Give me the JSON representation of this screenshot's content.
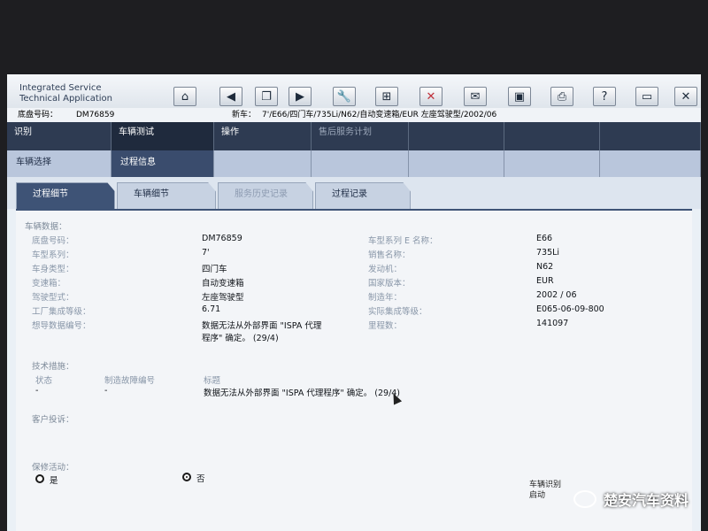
{
  "app": {
    "title_line1": "Integrated Service",
    "title_line2": "Technical Application"
  },
  "toolbar": {
    "icons": [
      "home-icon",
      "back-icon",
      "copy-icon",
      "forward-icon",
      "wrench-icon",
      "network-icon",
      "disconnect-icon",
      "mail-icon",
      "device-icon",
      "print-icon",
      "help-icon",
      "window-icon",
      "close-icon"
    ]
  },
  "vehicle_bar": {
    "chassis_label": "底盘号码：",
    "chassis_value": "DM76859",
    "new_car_label": "新车：",
    "new_car_value": "7'/E66/四门车/735Li/N62/自动变速箱/EUR 左座驾驶型/2002/06"
  },
  "nav_main": [
    "识别",
    "车辆测试",
    "操作",
    "售后服务计划",
    "",
    "",
    ""
  ],
  "nav_sub": [
    "车辆选择",
    "过程信息"
  ],
  "tabs": [
    "过程细节",
    "车辆细节",
    "服务历史记录",
    "过程记录"
  ],
  "vehicle_data": {
    "section_title": "车辆数据：",
    "left_labels": [
      "底盘号码：",
      "车型系列：",
      "车身类型：",
      "变速箱：",
      "驾驶型式：",
      "工厂集成等级：",
      "想导数据编号："
    ],
    "left_values": [
      "DM76859",
      "7'",
      "四门车",
      "自动变速箱",
      "左座驾驶型",
      "6.71",
      "数据无法从外部界面 \"ISPA 代理",
      "程序\" 确定。 (29/4)"
    ],
    "right_labels": [
      "车型系列 E 名称：",
      "销售名称：",
      "发动机：",
      "国家版本：",
      "制造年：",
      "实际集成等级：",
      "里程数："
    ],
    "right_values": [
      "E66",
      "735Li",
      "N62",
      "EUR",
      "2002 / 06",
      "E065-06-09-800",
      "141097"
    ]
  },
  "technical_measures": {
    "section_title": "技术措施：",
    "col1": "状态",
    "col2": "制造故障编号",
    "col3": "标题",
    "dash1": "-",
    "dash2": "-",
    "message": "数据无法从外部界面 \"ISPA 代理程序\" 确定。 (29/4)"
  },
  "customer_complaint": {
    "section_title": "客户投诉："
  },
  "service_campaign": {
    "section_title": "保修活动：",
    "option_yes": "是",
    "option_no": "否",
    "selected": "否"
  },
  "bottom_button": {
    "label_line1": "车辆识别",
    "label_line2": "启动"
  },
  "watermark": {
    "text": "楚安汽车资料"
  }
}
